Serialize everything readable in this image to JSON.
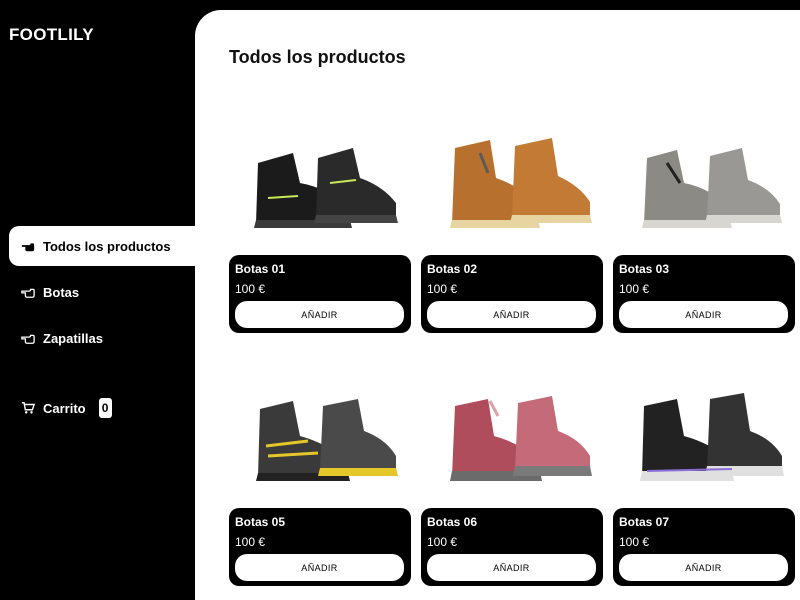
{
  "brand": {
    "logo": "FOOTLILY"
  },
  "sidebar": {
    "items": [
      {
        "label": "Todos los productos",
        "icon": "pointing-hand-icon"
      },
      {
        "label": "Botas",
        "icon": "pointing-hand-outline-icon"
      },
      {
        "label": "Zapatillas",
        "icon": "pointing-hand-outline-icon"
      }
    ],
    "cart": {
      "label": "Carrito",
      "count": "0",
      "icon": "cart-icon"
    }
  },
  "main": {
    "title": "Todos los productos",
    "products": [
      {
        "name": "Botas 01",
        "price": "100 €",
        "button": "AÑADIR",
        "colors": [
          "#1b1b1b",
          "#c8e85a"
        ]
      },
      {
        "name": "Botas 02",
        "price": "100 €",
        "button": "AÑADIR",
        "colors": [
          "#b8702e",
          "#e8d4a0"
        ]
      },
      {
        "name": "Botas 03",
        "price": "100 €",
        "button": "AÑADIR",
        "colors": [
          "#8c8a85",
          "#d8d6d0"
        ]
      },
      {
        "name": "Botas 05",
        "price": "100 €",
        "button": "AÑADIR",
        "colors": [
          "#3a3a3a",
          "#e5c72a"
        ]
      },
      {
        "name": "Botas 06",
        "price": "100 €",
        "button": "AÑADIR",
        "colors": [
          "#b04d5c",
          "#d8a0a8"
        ]
      },
      {
        "name": "Botas 07",
        "price": "100 €",
        "button": "AÑADIR",
        "colors": [
          "#222222",
          "#8c6fd8"
        ]
      }
    ]
  }
}
